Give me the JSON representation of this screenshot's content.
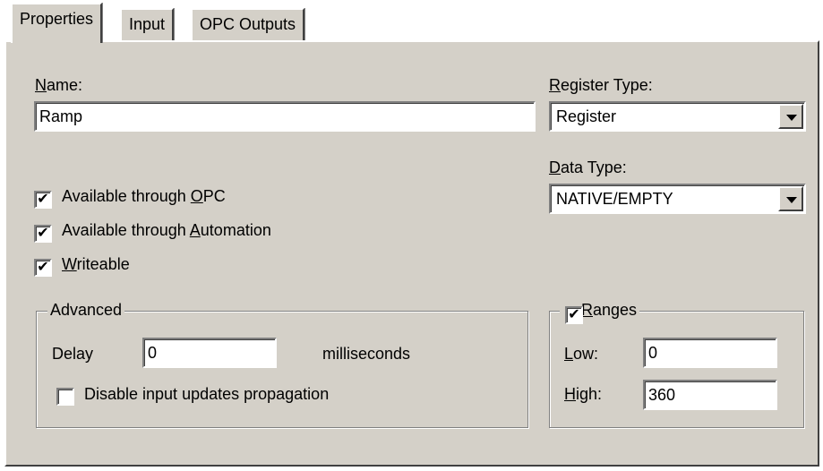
{
  "tabs": [
    {
      "label": "Properties"
    },
    {
      "label": "Input"
    },
    {
      "label": "OPC Outputs"
    }
  ],
  "name": {
    "label_pre": "",
    "label_ul": "N",
    "label_post": "ame:",
    "value": "Ramp"
  },
  "register_type": {
    "label_ul": "R",
    "label_post": "egister Type:",
    "value": "Register"
  },
  "data_type": {
    "label_ul": "D",
    "label_post": "ata Type:",
    "value": "NATIVE/EMPTY"
  },
  "checkboxes": {
    "opc": {
      "pre": "Available through ",
      "ul": "O",
      "post": "PC",
      "checked": true,
      "mark": "✔"
    },
    "automation": {
      "pre": "Available through ",
      "ul": "A",
      "post": "utomation",
      "checked": true,
      "mark": "✔"
    },
    "writeable": {
      "pre": "",
      "ul": "W",
      "post": "riteable",
      "checked": true,
      "mark": "✔"
    }
  },
  "advanced": {
    "legend": "Advanced",
    "delay_label": "Delay",
    "delay_value": "0",
    "delay_unit": "milliseconds",
    "disable_label": "Disable input updates propagation",
    "disable_checked": false
  },
  "ranges": {
    "legend_ul": "R",
    "legend_post": "anges",
    "checked": true,
    "mark": "✔",
    "low_ul": "L",
    "low_post": "ow:",
    "low_value": "0",
    "high_ul": "H",
    "high_post": "igh:",
    "high_value": "360"
  }
}
